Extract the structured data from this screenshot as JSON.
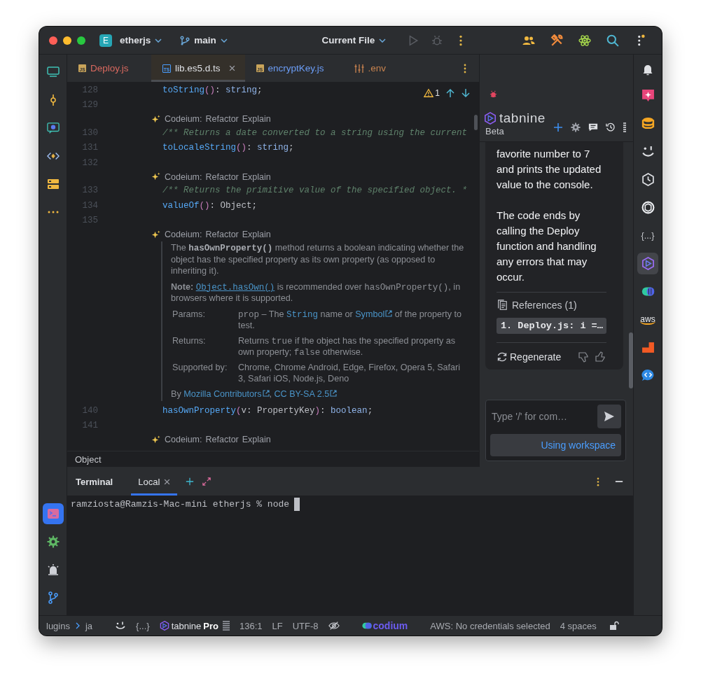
{
  "title_bar": {
    "project_badge": "E",
    "project": "etherjs",
    "branch": "main",
    "run_config": "Current File"
  },
  "left_toolbar": {
    "top": [
      {
        "selected": false
      },
      {
        "selected": false
      },
      {
        "selected": false
      },
      {
        "selected": false
      },
      {
        "selected": false
      },
      {
        "selected": false
      }
    ],
    "bottom": [
      {
        "selected": true
      },
      {
        "selected": false
      },
      {
        "selected": false
      },
      {
        "selected": false
      }
    ]
  },
  "editor_tabs": [
    {
      "label": "Deploy.js",
      "badge": "JS",
      "color": "#d9695f",
      "selected": false
    },
    {
      "label": "lib.es5.d.ts",
      "badge": "TS",
      "color": "#dfe1e5",
      "selected": true
    },
    {
      "label": "encryptKey.js",
      "badge": "JS",
      "color": "#6c9ef8",
      "selected": false
    },
    {
      "label": ".env",
      "color": "#c8834f",
      "selected": false
    }
  ],
  "inspection": {
    "warnings": "1"
  },
  "editor_lines": [
    {
      "kind": "code",
      "number": "128",
      "tokens": [
        {
          "kind": "fn",
          "text": "toString"
        },
        {
          "kind": "paren",
          "text": "()"
        },
        {
          "kind": "plain",
          "text": ": "
        },
        {
          "kind": "type",
          "text": "string"
        },
        {
          "kind": "plain",
          "text": ";"
        }
      ]
    },
    {
      "kind": "code",
      "number": "129"
    },
    {
      "kind": "lens",
      "label": "Codeium:",
      "actions": [
        "Refactor",
        "Explain"
      ]
    },
    {
      "kind": "code",
      "number": "130",
      "tokens": [
        {
          "kind": "comment",
          "text": "/** Returns a date converted to a string using the current"
        }
      ]
    },
    {
      "kind": "code",
      "number": "131",
      "tokens": [
        {
          "kind": "fn",
          "text": "toLocaleString"
        },
        {
          "kind": "paren",
          "text": "()"
        },
        {
          "kind": "plain",
          "text": ": "
        },
        {
          "kind": "type",
          "text": "string"
        },
        {
          "kind": "plain",
          "text": ";"
        }
      ]
    },
    {
      "kind": "code",
      "number": "132"
    },
    {
      "kind": "lens",
      "label": "Codeium:",
      "actions": [
        "Refactor",
        "Explain"
      ]
    },
    {
      "kind": "code",
      "number": "133",
      "tokens": [
        {
          "kind": "comment",
          "text": "/** Returns the primitive value of the specified object. *"
        }
      ]
    },
    {
      "kind": "code",
      "number": "134",
      "tokens": [
        {
          "kind": "fn",
          "text": "valueOf"
        },
        {
          "kind": "paren",
          "text": "()"
        },
        {
          "kind": "plain",
          "text": ": Object;"
        }
      ]
    },
    {
      "kind": "code",
      "number": "135"
    },
    {
      "kind": "lens",
      "label": "Codeium:",
      "actions": [
        "Refactor",
        "Explain"
      ]
    },
    {
      "kind": "doc",
      "paragraphs": [
        [
          {
            "kind": "text",
            "text": "The "
          },
          {
            "kind": "strong-code",
            "text": "hasOwnProperty()"
          },
          {
            "kind": "text",
            "text": " method returns a boolean indicating whether the object has the specified property as its own property (as opposed to inheriting it)."
          }
        ],
        [
          {
            "kind": "strong",
            "text": "Note: "
          },
          {
            "kind": "code-link",
            "text": "Object.hasOwn()"
          },
          {
            "kind": "text",
            "text": " is recommended over "
          },
          {
            "kind": "code",
            "text": "hasOwnProperty()"
          },
          {
            "kind": "text",
            "text": ", in browsers where it is supported."
          }
        ]
      ],
      "sections": [
        {
          "label": "Params:",
          "parts": [
            {
              "kind": "code",
              "text": "prop"
            },
            {
              "kind": "text",
              "text": " – The "
            },
            {
              "kind": "code-type",
              "text": "String"
            },
            {
              "kind": "text",
              "text": " name or "
            },
            {
              "kind": "link",
              "text": "Symbol"
            },
            {
              "kind": "text",
              "text": " of the property to test."
            }
          ]
        },
        {
          "label": "Returns:",
          "parts": [
            {
              "kind": "text",
              "text": "Returns "
            },
            {
              "kind": "code",
              "text": "true"
            },
            {
              "kind": "text",
              "text": " if the object has the specified property as own property; "
            },
            {
              "kind": "code",
              "text": "false"
            },
            {
              "kind": "text",
              "text": " otherwise."
            }
          ]
        },
        {
          "label": "Supported by:",
          "parts": [
            {
              "kind": "text",
              "text": "Chrome, Chrome Android, Edge, Firefox, Opera 5, Safari 3, Safari iOS, Node.js, Deno"
            }
          ]
        }
      ],
      "attribution": [
        {
          "kind": "text",
          "text": "By "
        },
        {
          "kind": "link",
          "text": "Mozilla Contributors"
        },
        {
          "kind": "text",
          "text": ", "
        },
        {
          "kind": "link",
          "text": "CC BY-SA 2.5"
        }
      ]
    },
    {
      "kind": "code",
      "number": "140",
      "tokens": [
        {
          "kind": "fn",
          "text": "hasOwnProperty"
        },
        {
          "kind": "paren",
          "text": "("
        },
        {
          "kind": "plain",
          "text": "v: PropertyKey"
        },
        {
          "kind": "paren",
          "text": ")"
        },
        {
          "kind": "plain",
          "text": ": "
        },
        {
          "kind": "type",
          "text": "boolean"
        },
        {
          "kind": "plain",
          "text": ";"
        }
      ]
    },
    {
      "kind": "code",
      "number": "141"
    },
    {
      "kind": "lens",
      "label": "Codeium:",
      "actions": [
        "Refactor",
        "Explain"
      ]
    }
  ],
  "breadcrumb": "Object",
  "tabnine": {
    "logo": "tabnine",
    "beta": "Beta",
    "messages": [
      "favorite number to 7 and prints the updated value to the console.",
      "The code ends by calling the Deploy function and handling any errors that may occur."
    ],
    "references_label": "References (1)",
    "references": [
      "1. Deploy.js: i =…"
    ],
    "regenerate": "Regenerate",
    "input_placeholder": "Type '/' for com…",
    "workspace_button": "Using workspace"
  },
  "right_toolbar": [
    {
      "selected": false
    },
    {
      "selected": false
    },
    {
      "selected": false
    },
    {
      "selected": false
    },
    {
      "selected": false
    },
    {
      "selected": false,
      "glyph": "{...}"
    },
    {
      "selected": true
    },
    {
      "selected": false
    },
    {
      "selected": false,
      "glyph": "aws"
    },
    {
      "selected": false
    },
    {
      "selected": false
    }
  ],
  "terminal": {
    "title": "Terminal",
    "tabs": [
      {
        "label": "Local",
        "selected": true
      }
    ],
    "lines": [
      "ramziosta@Ramzis-Mac-mini etherjs % node"
    ]
  },
  "status_bar": {
    "path": [
      "lugins",
      "ja"
    ],
    "braces": "{...}",
    "tabnine_brand": "tabnine",
    "tabnine_plan": "Pro",
    "position": "136:1",
    "line_separator": "LF",
    "encoding": "UTF-8",
    "codium": "codium",
    "aws": "AWS: No credentials selected",
    "indent": "4 spaces"
  }
}
